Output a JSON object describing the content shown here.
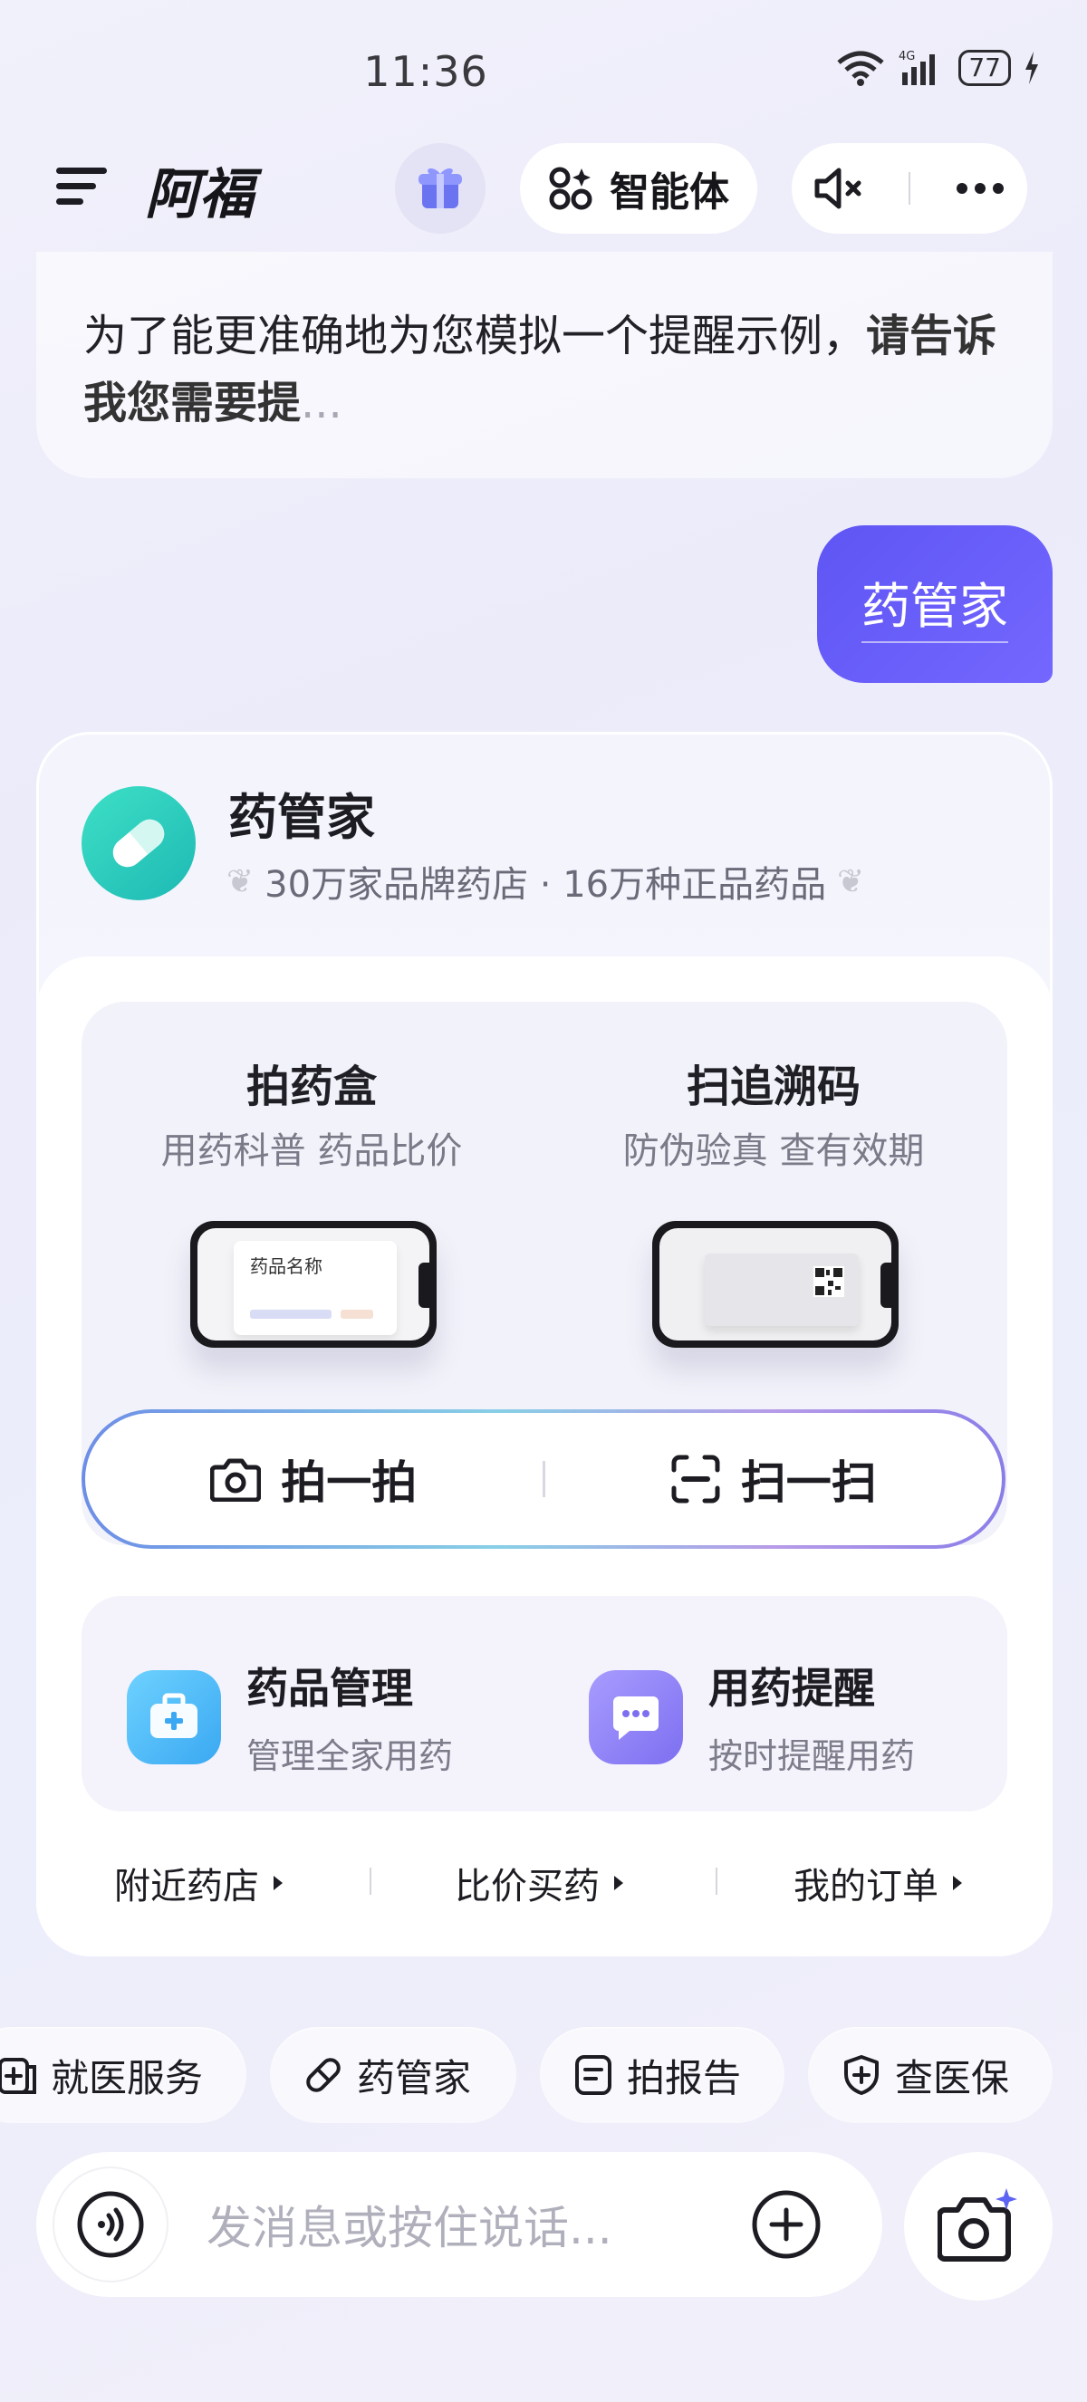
{
  "status_bar": {
    "time": "11:36",
    "battery": "77",
    "signal_label": "4G"
  },
  "header": {
    "menu_icon": "menu-icon",
    "title": "阿福",
    "agent_label": "智能体"
  },
  "assistant_message": {
    "text_main": "为了能更准确地为您模拟一个提醒示例，",
    "text_bold": "请告诉我您需要提",
    "text_fade": "..."
  },
  "user_message": {
    "text": "药管家"
  },
  "card": {
    "title": "药管家",
    "subtitle": "30万家品牌药店 · 16万种正品药品",
    "features": [
      {
        "title": "拍药盒",
        "subtitle": "用药科普 药品比价",
        "screen_text": "药品名称"
      },
      {
        "title": "扫追溯码",
        "subtitle": "防伪验真 查有效期"
      }
    ],
    "actions": [
      {
        "label": "拍一拍",
        "icon": "camera-icon"
      },
      {
        "label": "扫一扫",
        "icon": "scan-icon"
      }
    ],
    "management": [
      {
        "title": "药品管理",
        "subtitle": "管理全家用药",
        "icon": "medical-kit-icon",
        "color": "#4db8f5"
      },
      {
        "title": "用药提醒",
        "subtitle": "按时提醒用药",
        "icon": "chat-bubble-icon",
        "color": "#8b7df0"
      }
    ],
    "quick_links": [
      {
        "label": "附近药店"
      },
      {
        "label": "比价买药"
      },
      {
        "label": "我的订单"
      }
    ]
  },
  "chips": [
    {
      "label": "就医服务",
      "icon": "medical-service-icon"
    },
    {
      "label": "药管家",
      "icon": "pill-icon"
    },
    {
      "label": "拍报告",
      "icon": "report-icon"
    },
    {
      "label": "查医保",
      "icon": "shield-plus-icon"
    }
  ],
  "input": {
    "placeholder": "发消息或按住说话..."
  },
  "colors": {
    "accent": "#6359f5",
    "teal": "#2ccdbd"
  }
}
